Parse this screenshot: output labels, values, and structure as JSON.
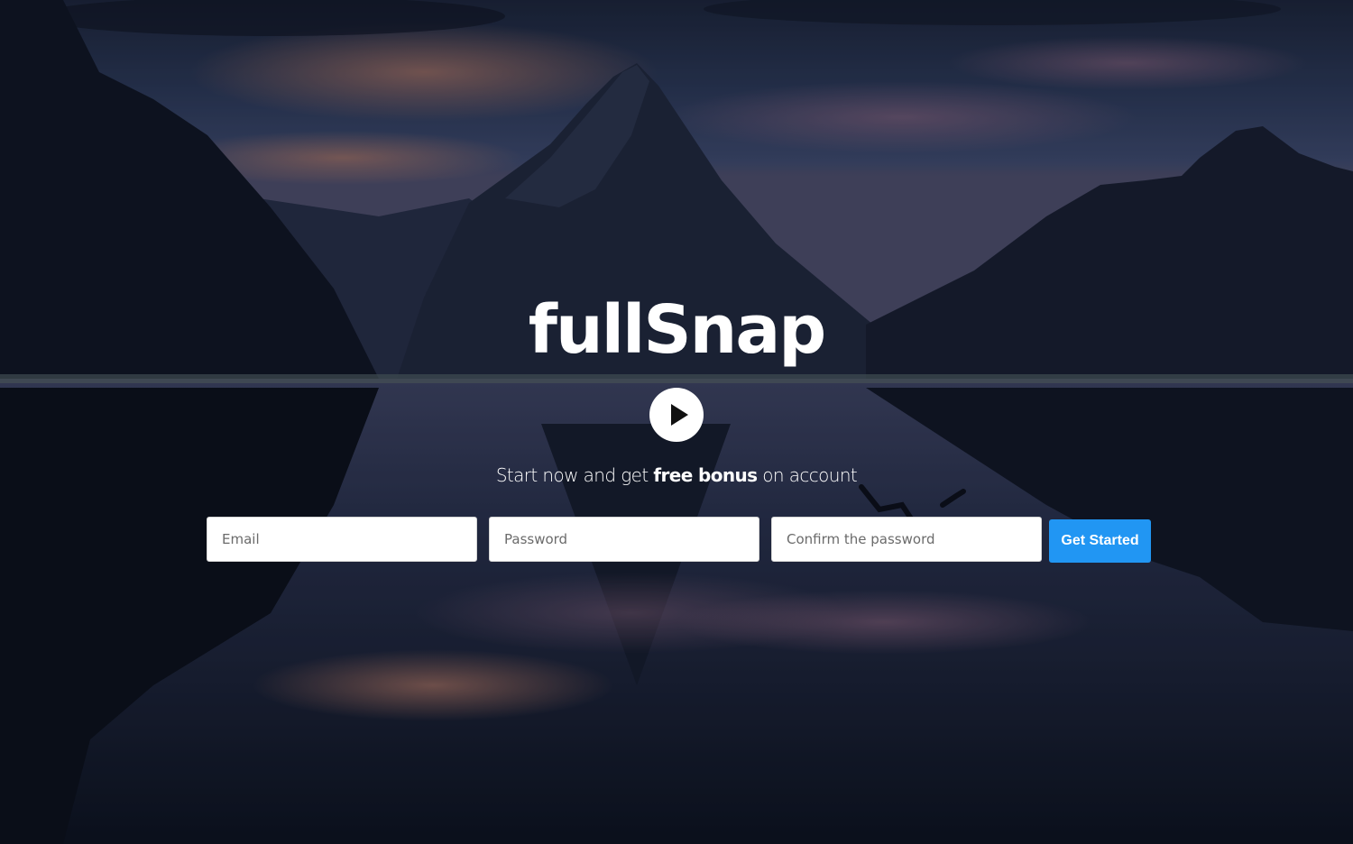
{
  "brand": {
    "title": "fullSnap"
  },
  "hero": {
    "play_icon": "play-icon",
    "tagline_prefix": "Start now and get ",
    "tagline_bold": "free bonus",
    "tagline_suffix": " on account"
  },
  "form": {
    "email_placeholder": "Email",
    "password_placeholder": "Password",
    "confirm_placeholder": "Confirm the password",
    "submit_label": "Get Started"
  },
  "colors": {
    "accent": "#2196f3",
    "text": "#ffffff"
  }
}
